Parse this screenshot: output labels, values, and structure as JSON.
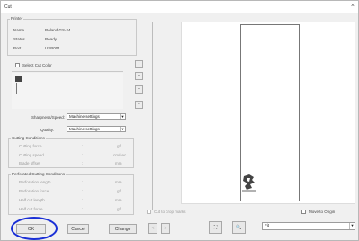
{
  "window": {
    "title": "Cut",
    "close_glyph": "×"
  },
  "printer": {
    "group_label": "Printer",
    "name_label": "Name",
    "name_value": "Roland GS-24",
    "status_label": "Status",
    "status_value": "Ready",
    "port_label": "Port",
    "port_value": "USB001"
  },
  "select_cut_color": {
    "label": "Select Cut Color",
    "swatch_color": "#444444"
  },
  "side_buttons": [
    "↕",
    "+",
    "+",
    "−"
  ],
  "quality": {
    "sharpness_label": "Sharpness/Speed:",
    "sharpness_value": "Machine settings",
    "quality_label": "Quality:",
    "quality_value": "Machine settings"
  },
  "cutting": {
    "group_label": "Cutting Conditions",
    "rows": [
      {
        "label": "Cutting force",
        "sep": ":",
        "unit": "gf"
      },
      {
        "label": "Cutting speed",
        "sep": ":",
        "unit": "cm/sec"
      },
      {
        "label": "Blade offset",
        "sep": ":",
        "unit": "mm"
      }
    ]
  },
  "perforated": {
    "group_label": "Perforated Cutting Conditions",
    "rows": [
      {
        "label": "Perforation length",
        "sep": ":",
        "unit": "mm"
      },
      {
        "label": "Perforation force",
        "sep": ":",
        "unit": "gf"
      },
      {
        "label": "Half cut length",
        "sep": ":",
        "unit": "mm"
      },
      {
        "label": "Half cut force",
        "sep": ":",
        "unit": "gf"
      }
    ]
  },
  "footer": {
    "ok": "OK",
    "cancel": "Cancel",
    "change": "Change"
  },
  "preview": {
    "cut_line_label": "Cut to crop marks",
    "nav_prev": "<",
    "nav_next": ">",
    "fit_icon": "⛶",
    "zoom_icon": "🔍",
    "move_to_origin": "Move to Origin",
    "view_select_value": "Fit",
    "highlight_color": "#1a2fd6"
  }
}
